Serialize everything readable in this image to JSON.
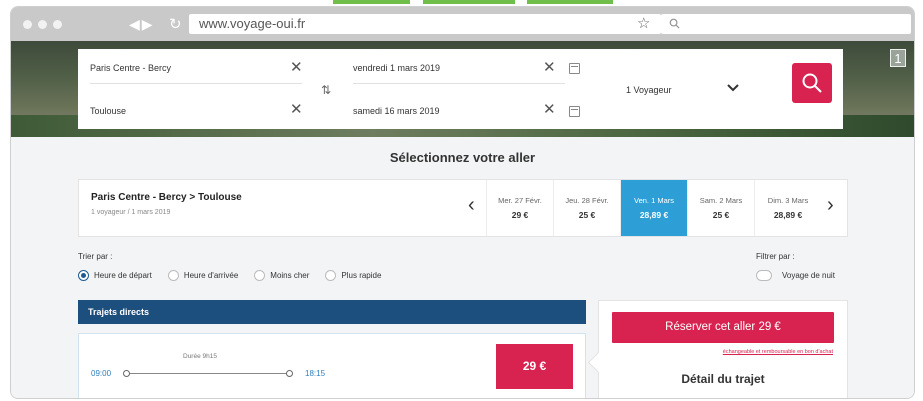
{
  "browser": {
    "url": "www.voyage-oui.fr",
    "page_badge": "1"
  },
  "search": {
    "origin": "Paris Centre - Bercy",
    "destination": "Toulouse",
    "outbound_date": "vendredi 1 mars 2019",
    "return_date": "samedi 16 mars 2019",
    "travelers": "1 Voyageur"
  },
  "results": {
    "section_title": "Sélectionnez votre aller",
    "route": "Paris Centre - Bercy > Toulouse",
    "route_sub": "1 voyageur / 1 mars 2019",
    "dates": [
      {
        "label": "Mer. 27 Févr.",
        "price": "29 €",
        "active": false
      },
      {
        "label": "Jeu. 28 Févr.",
        "price": "25 €",
        "active": false
      },
      {
        "label": "Ven. 1 Mars",
        "price": "28,89 €",
        "active": true
      },
      {
        "label": "Sam. 2 Mars",
        "price": "25 €",
        "active": false
      },
      {
        "label": "Dim. 3 Mars",
        "price": "28,89 €",
        "active": false
      }
    ]
  },
  "sort": {
    "label": "Trier par :",
    "options": [
      {
        "label": "Heure de départ",
        "selected": true
      },
      {
        "label": "Heure d'arrivée",
        "selected": false
      },
      {
        "label": "Moins cher",
        "selected": false
      },
      {
        "label": "Plus rapide",
        "selected": false
      }
    ]
  },
  "filter": {
    "label": "Filtrer par :",
    "night_label": "Voyage de nuit"
  },
  "trips": {
    "section_label": "Trajets directs",
    "first": {
      "duration": "Durée 9h15",
      "departure": "09:00",
      "arrival": "18:15",
      "price": "29 €"
    }
  },
  "panel": {
    "reserve_label": "Réserver cet aller 29 €",
    "fine_print": "échangeable et remboursable en bon d'achat",
    "detail_title": "Détail du trajet"
  },
  "colors": {
    "accent": "#d8224f",
    "selected_date": "#2d9fd6",
    "section_bar": "#1d4f7e"
  }
}
